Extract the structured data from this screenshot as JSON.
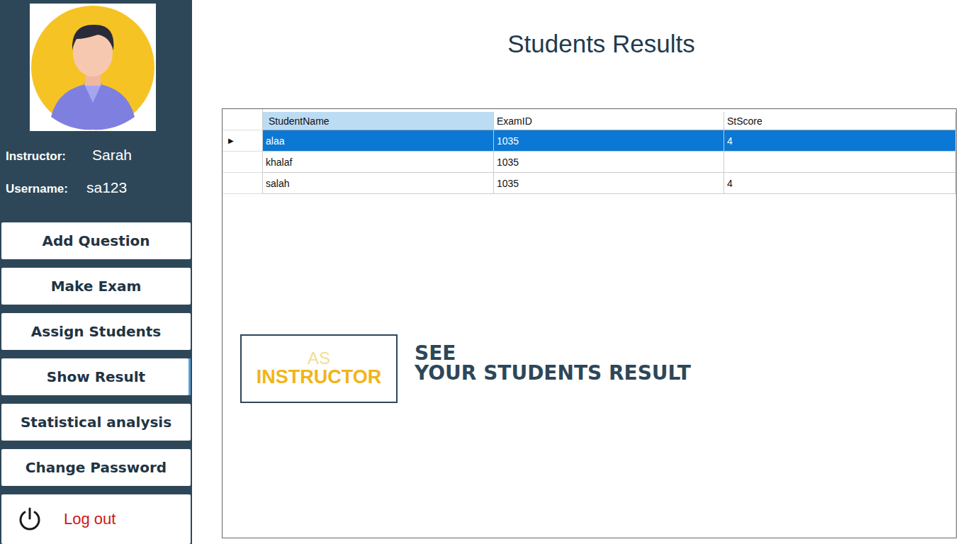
{
  "sidebar": {
    "instructor_label": "Instructor:",
    "instructor": "Sarah",
    "username_label": "Username:",
    "username": "sa123",
    "items": [
      {
        "label": "Add Question",
        "selected": false
      },
      {
        "label": "Make Exam",
        "selected": false
      },
      {
        "label": "Assign Students",
        "selected": false
      },
      {
        "label": "Show Result",
        "selected": true
      },
      {
        "label": "Statistical analysis",
        "selected": false
      },
      {
        "label": "Change Password",
        "selected": false
      }
    ],
    "logout": "Log out"
  },
  "title": "Students Results",
  "table": {
    "marker": "▶",
    "columns": [
      "StudentName",
      "ExamID",
      "StScore"
    ],
    "rows": [
      {
        "cells": [
          "alaa",
          "1035",
          "4"
        ],
        "selected": true
      },
      {
        "cells": [
          "khalaf",
          "1035",
          ""
        ],
        "selected": false
      },
      {
        "cells": [
          "salah",
          "1035",
          "4"
        ],
        "selected": false
      }
    ]
  },
  "overlay": {
    "badge_top": "AS",
    "badge_bottom": "INSTRUCTOR",
    "line1": "SEE",
    "line2": "YOUR STUDENTS RESULT"
  }
}
